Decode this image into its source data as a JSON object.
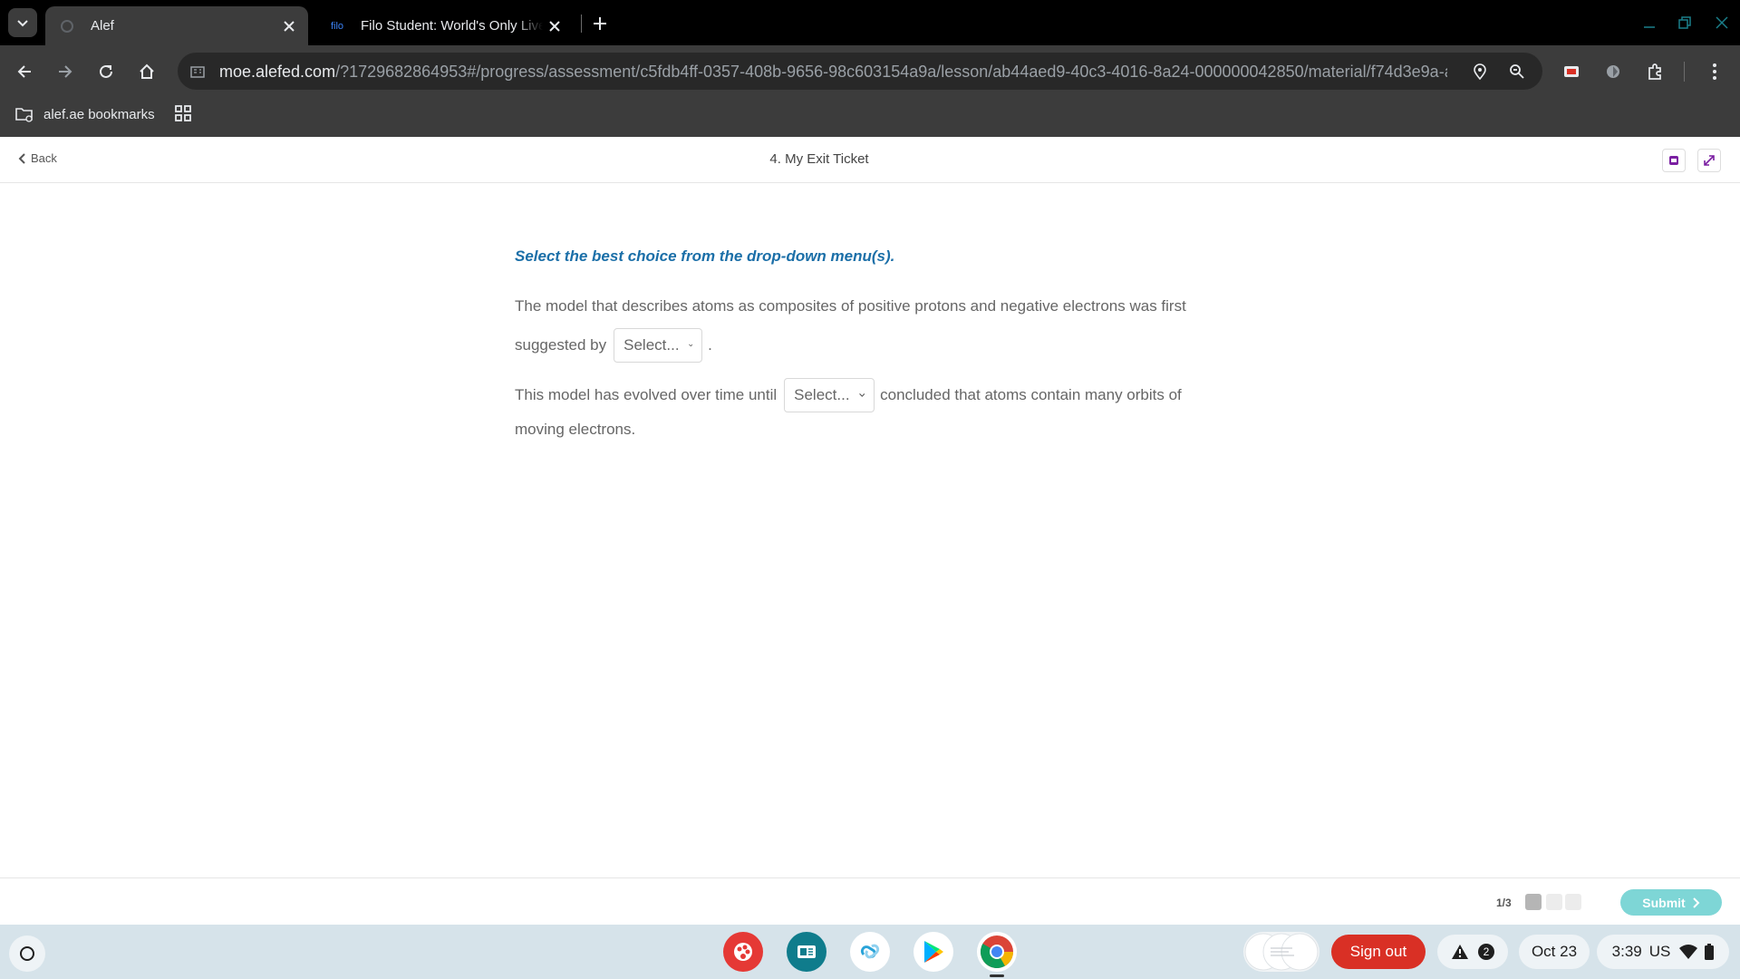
{
  "browser": {
    "tabs": [
      {
        "title": "Alef",
        "favicon": "alef-icon",
        "active": true
      },
      {
        "title": "Filo Student: World's Only Live Instant Tutoring",
        "favicon_text": "filo",
        "active": false
      }
    ],
    "url": {
      "host": "moe.alefed.com",
      "path": "/?1729682864953#/progress/assessment/c5fdb4ff-0357-408b-9656-98c603154a9a/lesson/ab44aed9-40c3-4016-8a24-000000042850/material/f74d3e9a-a..."
    },
    "bookmarks": [
      {
        "label": "alef.ae bookmarks"
      }
    ]
  },
  "lesson": {
    "back_label": "Back",
    "title": "4. My Exit Ticket"
  },
  "question": {
    "instruction": "Select the best choice from the drop-down menu(s).",
    "line1": "The model that describes atoms as composites of positive protons and negative electrons was first",
    "line2_before": "suggested by",
    "line2_after": ".",
    "line3_before": "This model has evolved over time until",
    "line3_after": "concluded that atoms contain many orbits of",
    "line4": "moving electrons.",
    "select1": {
      "value": "Select..."
    },
    "select2": {
      "value": "Select..."
    }
  },
  "footer": {
    "pager": "1/3",
    "submit_label": "Submit"
  },
  "shelf": {
    "signout_label": "Sign out",
    "notifications_count": "2",
    "date": "Oct 23",
    "time": "3:39",
    "locale": "US"
  },
  "colors": {
    "instruction": "#1b6fa8",
    "submit": "#7ed6d6",
    "signout": "#d93025"
  }
}
